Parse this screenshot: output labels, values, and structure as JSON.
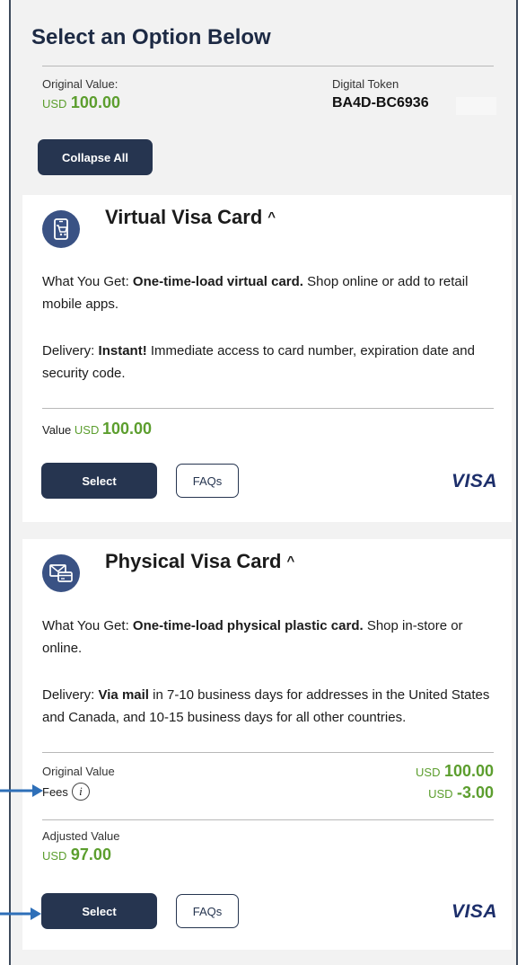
{
  "header": {
    "title": "Select an Option Below",
    "original_value_label": "Original Value:",
    "currency": "USD",
    "original_value": "100.00",
    "token_label": "Digital Token",
    "token_value": "BA4D-BC6936",
    "collapse_all_label": "Collapse All"
  },
  "cards": [
    {
      "title": "Virtual Visa Card",
      "chevron": "^",
      "icon": "mobile-cart-icon",
      "what_label": "What You Get:",
      "what_bold": "One-time-load virtual card.",
      "what_rest": "Shop online or add to retail mobile apps.",
      "delivery_label": "Delivery:",
      "delivery_bold": "Instant!",
      "delivery_rest": "Immediate access to card number, expiration date and security code.",
      "value_label": "Value",
      "currency": "USD",
      "value": "100.00",
      "select_label": "Select",
      "faqs_label": "FAQs",
      "brand": "VISA"
    },
    {
      "title": "Physical Visa Card",
      "chevron": "^",
      "icon": "mail-card-icon",
      "what_label": "What You Get:",
      "what_bold": "One-time-load physical plastic card.",
      "what_rest": "Shop in-store or online.",
      "delivery_label": "Delivery:",
      "delivery_bold": "Via mail",
      "delivery_rest": "in 7-10 business days for addresses in the United States and Canada, and 10-15 business days for all other countries.",
      "original_value_label": "Original Value",
      "fees_label": "Fees",
      "info_icon": "i",
      "currency": "USD",
      "original_value": "100.00",
      "fees_value": "-3.00",
      "adjusted_label": "Adjusted Value",
      "adjusted_value": "97.00",
      "select_label": "Select",
      "faqs_label": "FAQs",
      "brand": "VISA"
    }
  ],
  "colors": {
    "primary": "#263550",
    "accent_green": "#5c9e2e",
    "visa_blue": "#1d2f6b",
    "icon_circle": "#3a5284",
    "arrow": "#2e6fb8"
  }
}
